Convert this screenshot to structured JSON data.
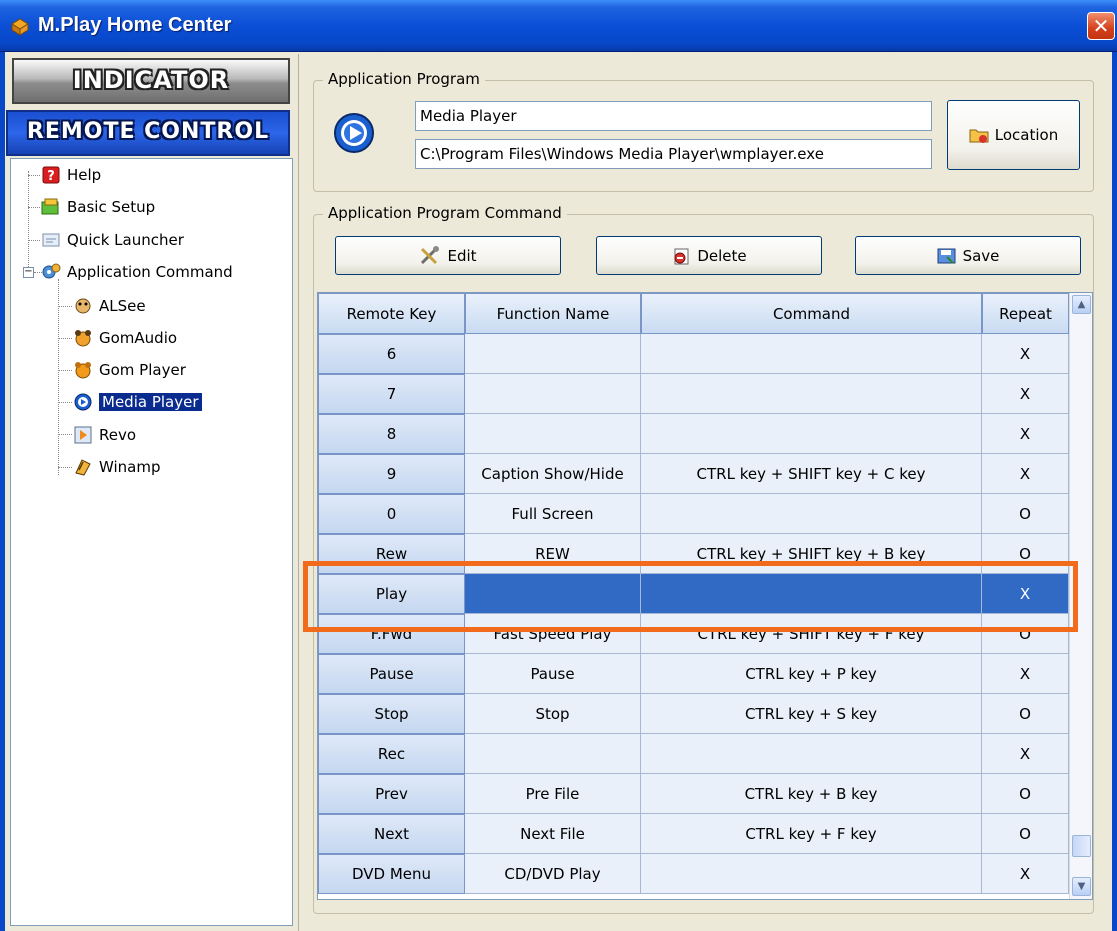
{
  "window": {
    "title": "M.Play Home Center",
    "close_glyph": "✕"
  },
  "left": {
    "indicator_label": "INDICATOR",
    "remote_label": "REMOTE CONTROL",
    "tree": {
      "help": "Help",
      "basic_setup": "Basic Setup",
      "quick_launcher": "Quick Launcher",
      "application_command": "Application Command",
      "apps": [
        "ALSee",
        "GomAudio",
        "Gom Player",
        "Media Player",
        "Revo",
        "Winamp"
      ],
      "selected": "Media Player"
    }
  },
  "application_program": {
    "legend": "Application Program",
    "name": "Media Player",
    "path": "C:\\Program Files\\Windows Media Player\\wmplayer.exe",
    "location_label": "Location"
  },
  "command_group": {
    "legend": "Application Program Command",
    "edit_label": "Edit",
    "delete_label": "Delete",
    "save_label": "Save"
  },
  "table": {
    "headers": [
      "Remote Key",
      "Function Name",
      "Command",
      "Repeat"
    ],
    "rows": [
      {
        "key": "6",
        "function": "",
        "command": "",
        "repeat": "X"
      },
      {
        "key": "7",
        "function": "",
        "command": "",
        "repeat": "X"
      },
      {
        "key": "8",
        "function": "",
        "command": "",
        "repeat": "X"
      },
      {
        "key": "9",
        "function": "Caption Show/Hide",
        "command": "CTRL key + SHIFT key + C key",
        "repeat": "X"
      },
      {
        "key": "0",
        "function": "Full Screen",
        "command": "",
        "repeat": "O"
      },
      {
        "key": "Rew",
        "function": "REW",
        "command": "CTRL key + SHIFT key + B key",
        "repeat": "O"
      },
      {
        "key": "Play",
        "function": "",
        "command": "",
        "repeat": "X"
      },
      {
        "key": "F.Fwd",
        "function": "Fast Speed Play",
        "command": "CTRL key + SHIFT key + F key",
        "repeat": "O"
      },
      {
        "key": "Pause",
        "function": "Pause",
        "command": "CTRL key + P key",
        "repeat": "X"
      },
      {
        "key": "Stop",
        "function": "Stop",
        "command": "CTRL key + S key",
        "repeat": "O"
      },
      {
        "key": "Rec",
        "function": "",
        "command": "",
        "repeat": "X"
      },
      {
        "key": "Prev",
        "function": "Pre File",
        "command": "CTRL key + B key",
        "repeat": "O"
      },
      {
        "key": "Next",
        "function": "Next File",
        "command": "CTRL key + F key",
        "repeat": "O"
      },
      {
        "key": "DVD Menu",
        "function": "CD/DVD Play",
        "command": "",
        "repeat": "X"
      }
    ],
    "selected_row": "Play"
  },
  "colors": {
    "selection": "#316ac5",
    "highlight_box": "#f26a1b",
    "titlebar": "#0a4fd6"
  }
}
